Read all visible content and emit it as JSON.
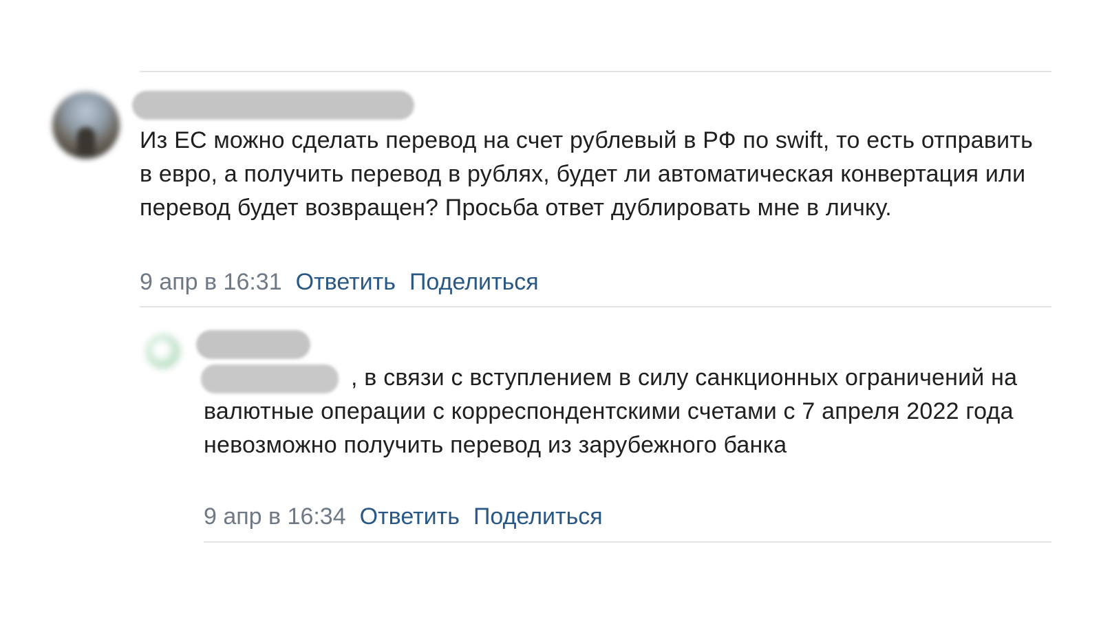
{
  "comments": [
    {
      "author": "",
      "text": "Из ЕС можно сделать перевод на счет рублевый в РФ по swift, то есть отправить в евро, а получить перевод в рублях, будет ли автоматическая конвертация или перевод будет возвращен? Просьба ответ дублировать мне в личку.",
      "date": "9 апр в 16:31",
      "reply_label": "Ответить",
      "share_label": "Поделиться"
    }
  ],
  "replies": [
    {
      "author": "",
      "text": ", в связи с вступлением в силу санкционных ограничений на валютные операции с корреспондентскими счетами с 7 апреля 2022 года невозможно получить перевод из зарубежного банка",
      "date": "9 апр в 16:34",
      "reply_label": "Ответить",
      "share_label": "Поделиться"
    }
  ],
  "colors": {
    "text": "#1f1f1f",
    "meta": "#6f7985",
    "link": "#2a5885",
    "divider": "#e3e4e8",
    "blur": "#c4c4c4"
  }
}
